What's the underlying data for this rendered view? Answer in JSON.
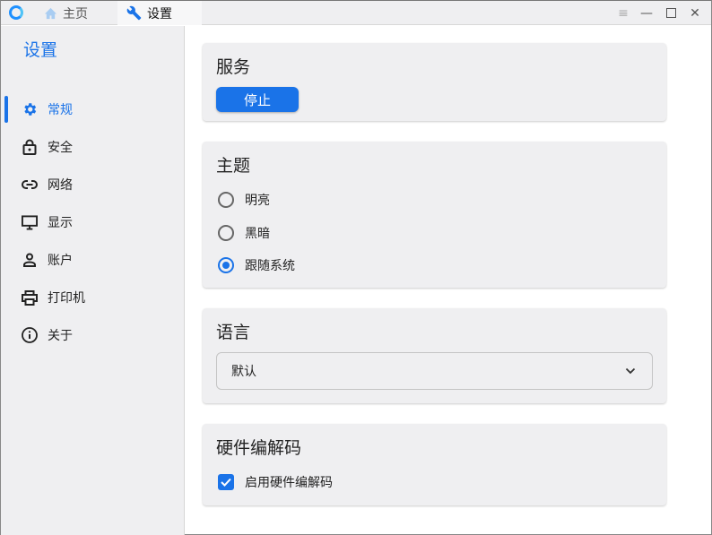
{
  "tabs": [
    {
      "label": "主页",
      "icon": "home-icon"
    },
    {
      "label": "设置",
      "icon": "wrench-icon"
    }
  ],
  "sidebar": {
    "title": "设置",
    "items": [
      {
        "label": "常规"
      },
      {
        "label": "安全"
      },
      {
        "label": "网络"
      },
      {
        "label": "显示"
      },
      {
        "label": "账户"
      },
      {
        "label": "打印机"
      },
      {
        "label": "关于"
      }
    ]
  },
  "service": {
    "title": "服务",
    "button": "停止"
  },
  "theme": {
    "title": "主题",
    "options": [
      {
        "label": "明亮"
      },
      {
        "label": "黑暗"
      },
      {
        "label": "跟随系统"
      }
    ],
    "selected": "跟随系统"
  },
  "language": {
    "title": "语言",
    "value": "默认"
  },
  "hwcodec": {
    "title": "硬件编解码",
    "checkbox": "启用硬件编解码",
    "checked": true
  },
  "colors": {
    "accent": "#1a73e8"
  }
}
